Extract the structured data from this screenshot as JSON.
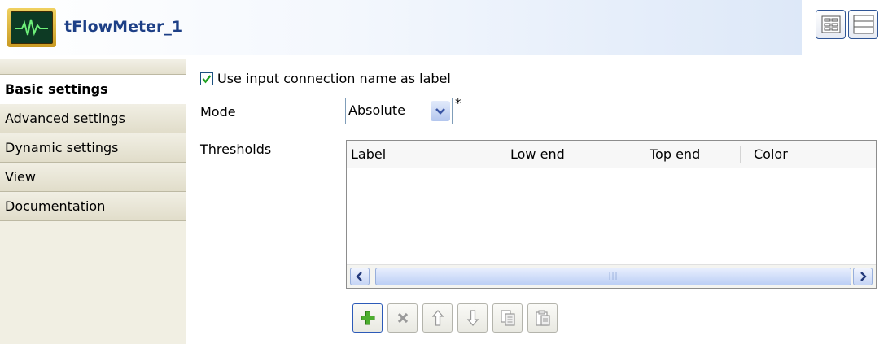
{
  "header": {
    "title": "tFlowMeter_1",
    "icon": "flow-meter-icon"
  },
  "view_buttons": [
    {
      "name": "grid-layout-icon"
    },
    {
      "name": "stacked-layout-icon"
    }
  ],
  "tabs": [
    {
      "label": "Basic settings",
      "active": true
    },
    {
      "label": "Advanced settings",
      "active": false
    },
    {
      "label": "Dynamic settings",
      "active": false
    },
    {
      "label": "View",
      "active": false
    },
    {
      "label": "Documentation",
      "active": false
    }
  ],
  "form": {
    "use_input_label": "Use input connection name as label",
    "use_input_checked": true,
    "mode_label": "Mode",
    "mode_value": "Absolute",
    "required_mark": "*",
    "thresholds_label": "Thresholds"
  },
  "thresholds_table": {
    "columns": [
      "Label",
      "Low end",
      "Top end",
      "Color"
    ],
    "rows": [],
    "scroll_grip": "|||"
  },
  "table_toolbar": [
    {
      "name": "add-icon",
      "enabled": true
    },
    {
      "name": "remove-icon",
      "enabled": false
    },
    {
      "name": "move-up-icon",
      "enabled": false
    },
    {
      "name": "move-down-icon",
      "enabled": false
    },
    {
      "name": "copy-icon",
      "enabled": false
    },
    {
      "name": "paste-icon",
      "enabled": false
    }
  ],
  "colors": {
    "title": "#1d3f86",
    "accent_border": "#2c5ab8",
    "checkbox_tick": "#21a121",
    "add_green": "#4cae2e"
  }
}
